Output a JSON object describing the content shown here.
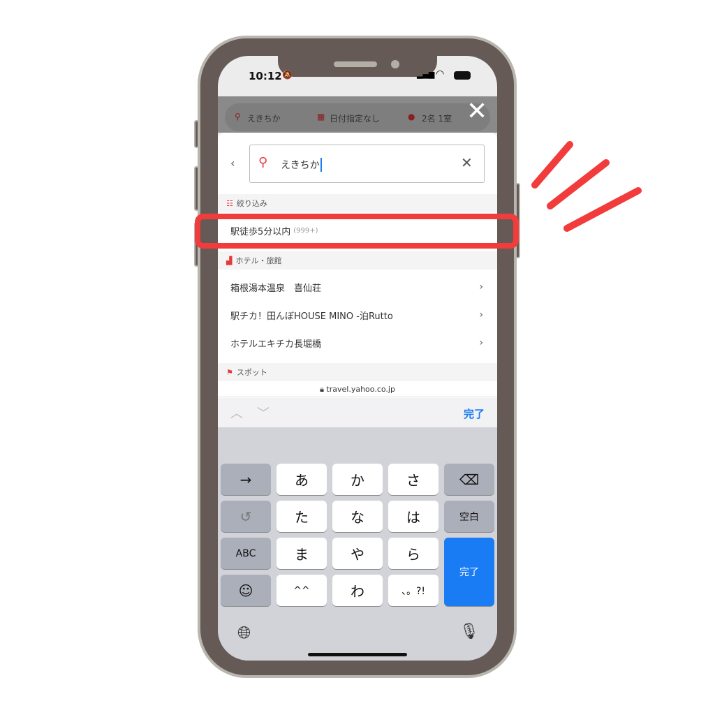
{
  "status": {
    "time": "10:12"
  },
  "topbar": {
    "keyword": "えきちか",
    "date": "日付指定なし",
    "guests": "2名 1室"
  },
  "search": {
    "value": "えきちか"
  },
  "filter": {
    "header": "絞り込み",
    "item": "駅徒歩5分以内",
    "count": "(999+)"
  },
  "hotels": {
    "header": "ホテル・旅館",
    "items": [
      "箱根湯本温泉　喜仙荘",
      "駅チカ！田んぼHOUSE MINO -泊Rutto",
      "ホテルエキチカ長堀橋"
    ]
  },
  "spots": {
    "header": "スポット"
  },
  "browser": {
    "url": "travel.yahoo.co.jp",
    "done": "完了"
  },
  "keyboard": {
    "rows": [
      [
        "→",
        "あ",
        "か",
        "さ",
        "⌫"
      ],
      [
        "↺",
        "た",
        "な",
        "は",
        "空白"
      ],
      [
        "ABC",
        "ま",
        "や",
        "ら",
        "完了"
      ],
      [
        "☺",
        "^^",
        "わ",
        "、。?!"
      ]
    ]
  },
  "colors": {
    "accent": "#e4393c",
    "ios_blue": "#1a7cf5",
    "annotation": "#f23b3b"
  }
}
